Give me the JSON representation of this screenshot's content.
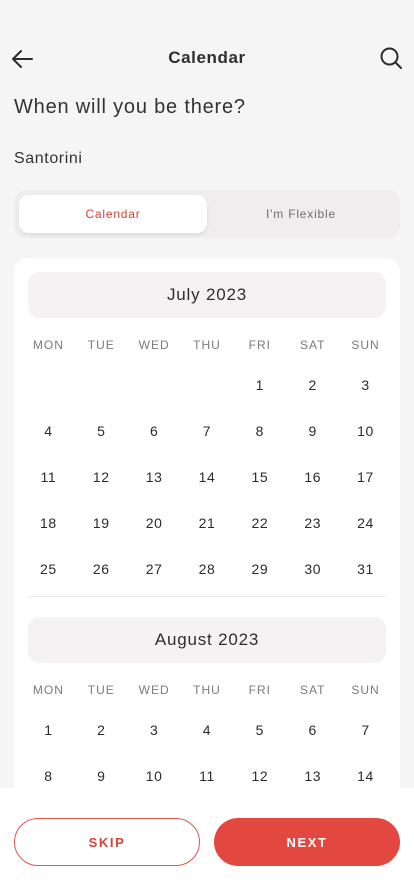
{
  "header": {
    "title": "Calendar"
  },
  "question": "When will you be there?",
  "destination": "Santorini",
  "toggle": {
    "calendar_label": "Calendar",
    "flexible_label": "I'm Flexible"
  },
  "weekdays": [
    "MON",
    "TUE",
    "WED",
    "THU",
    "FRI",
    "SAT",
    "SUN"
  ],
  "months": [
    {
      "name": "July 2023",
      "weeks": [
        [
          "",
          "",
          "",
          "",
          "1",
          "2",
          "3"
        ],
        [
          "4",
          "5",
          "6",
          "7",
          "8",
          "9",
          "10"
        ],
        [
          "11",
          "12",
          "13",
          "14",
          "15",
          "16",
          "17"
        ],
        [
          "18",
          "19",
          "20",
          "21",
          "22",
          "23",
          "24"
        ],
        [
          "25",
          "26",
          "27",
          "28",
          "29",
          "30",
          "31"
        ]
      ]
    },
    {
      "name": "August 2023",
      "weeks": [
        [
          "1",
          "2",
          "3",
          "4",
          "5",
          "6",
          "7"
        ],
        [
          "8",
          "9",
          "10",
          "11",
          "12",
          "13",
          "14"
        ]
      ]
    }
  ],
  "buttons": {
    "skip": "SKIP",
    "next": "NEXT"
  },
  "colors": {
    "accent": "#e2483f",
    "background": "#f6f5f5"
  }
}
